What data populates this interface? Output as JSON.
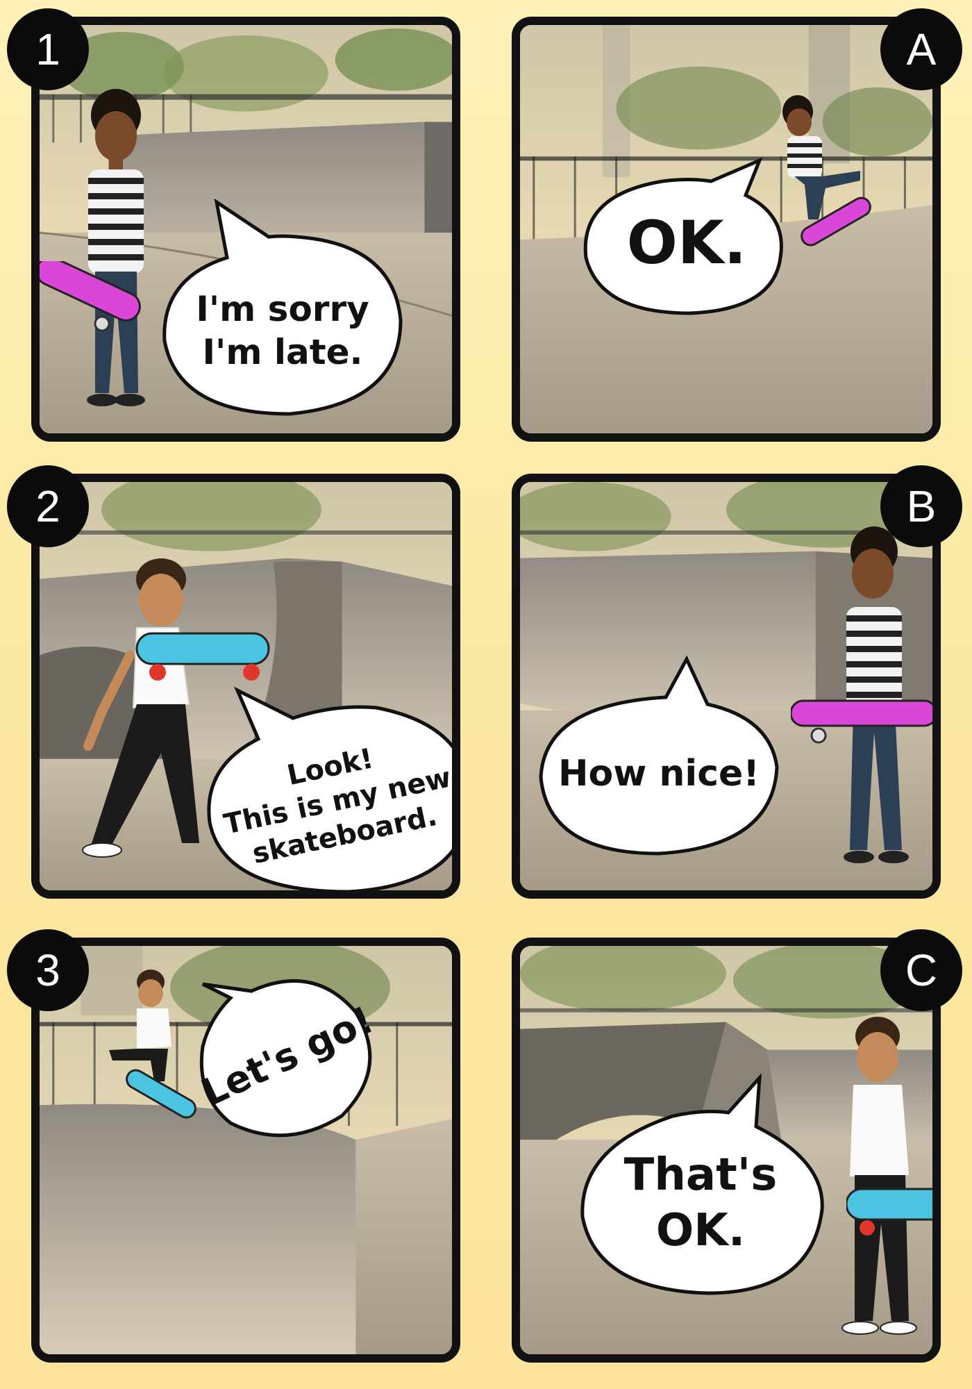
{
  "panels": [
    {
      "id": "1",
      "badge": "1",
      "speech": "I'm sorry\nI'm late."
    },
    {
      "id": "A",
      "badge": "A",
      "speech": "OK."
    },
    {
      "id": "2",
      "badge": "2",
      "speech": "Look!\nThis is my new\nskateboard."
    },
    {
      "id": "B",
      "badge": "B",
      "speech": "How nice!"
    },
    {
      "id": "3",
      "badge": "3",
      "speech": "Let's go!"
    },
    {
      "id": "C",
      "badge": "C",
      "speech": "That's\nOK."
    }
  ],
  "colors": {
    "background": "#fce9a6",
    "frame": "#111111",
    "deck_pink": "#d946d8",
    "deck_blue": "#4cc3e0",
    "wheel_red": "#e0362c"
  }
}
